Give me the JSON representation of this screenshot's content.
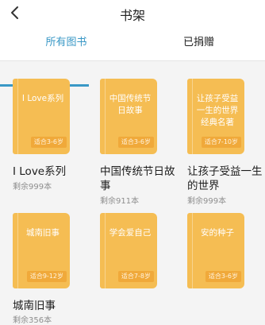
{
  "header": {
    "title": "书架",
    "back_icon": "chevron-left-icon"
  },
  "tabs": [
    {
      "label": "所有图书",
      "active": true
    },
    {
      "label": "已捐赠",
      "active": false
    }
  ],
  "colors": {
    "accent": "#3a98c6",
    "book_cover": "#f5bd53",
    "age_badge": "#f0a93a"
  },
  "books": [
    {
      "cover_title": "I Love系列",
      "age": "适合3-6岁",
      "title": "I Love系列",
      "remaining": "剩余999本"
    },
    {
      "cover_title": "中国传统节日故事",
      "age": "适合3-6岁",
      "title": "中国传统节日故事",
      "remaining": "剩余911本"
    },
    {
      "cover_title": "让孩子受益一生的世界经典名著",
      "age": "适合7-10岁",
      "title": "让孩子受益一生的世界",
      "remaining": "剩余999本"
    },
    {
      "cover_title": "城南旧事",
      "age": "适合9-12岁",
      "title": "城南旧事",
      "remaining": "剩余356本"
    },
    {
      "cover_title": "学会爱自己",
      "age": "适合7-8岁",
      "title": "",
      "remaining": ""
    },
    {
      "cover_title": "安的种子",
      "age": "适合3-6岁",
      "title": "",
      "remaining": ""
    }
  ]
}
